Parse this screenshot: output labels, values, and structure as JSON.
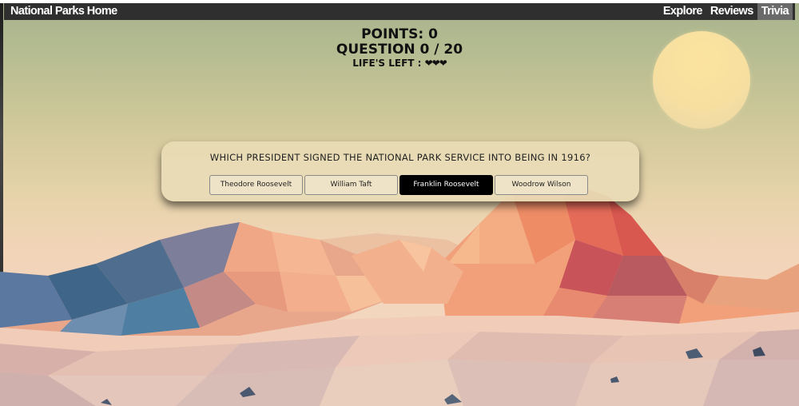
{
  "navbar": {
    "brand": "National Parks Home",
    "links": [
      {
        "label": "Explore"
      },
      {
        "label": "Reviews"
      },
      {
        "label": "Trivia"
      }
    ]
  },
  "score": {
    "points": "POINTS: 0",
    "question_count": "QUESTION 0 / 20",
    "lives_label": "LIFE'S LEFT : ",
    "hearts": "❤❤❤"
  },
  "quiz": {
    "question": "WHICH PRESIDENT SIGNED THE NATIONAL PARK SERVICE INTO BEING IN 1916?",
    "answers": [
      {
        "label": "Theodore Roosevelt"
      },
      {
        "label": "William Taft"
      },
      {
        "label": "Franklin Roosevelt"
      },
      {
        "label": "Woodrow Wilson"
      }
    ],
    "selected_answer": "Franklin Roosevelt"
  },
  "colors": {
    "navbar_bg": "#2f2f2f",
    "active_tab_bg": "#6a6a6a",
    "selected_answer_bg": "#000000",
    "sun": "#f7dfa0"
  }
}
